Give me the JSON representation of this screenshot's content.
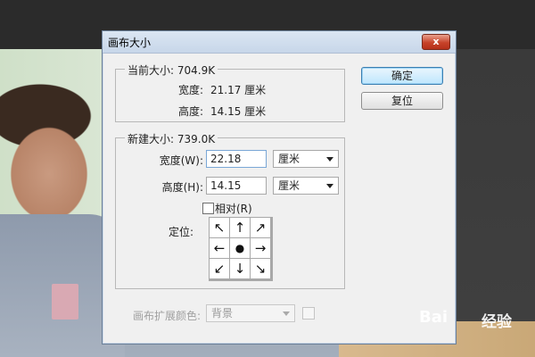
{
  "dialog": {
    "title": "画布大小",
    "close_label": "x"
  },
  "current_size": {
    "label": "当前大小: 704.9K",
    "width_label": "宽度:",
    "width_value": "21.17 厘米",
    "height_label": "高度:",
    "height_value": "14.15 厘米"
  },
  "new_size": {
    "label": "新建大小: 739.0K",
    "width_label": "宽度(W):",
    "width_value": "22.18",
    "width_unit": "厘米",
    "height_label": "高度(H):",
    "height_value": "14.15",
    "height_unit": "厘米",
    "relative_label": "相对(R)",
    "anchor_label": "定位:",
    "anchor_cells": [
      "↖",
      "↑",
      "↗",
      "←",
      "●",
      "→",
      "↙",
      "↓",
      "↘"
    ]
  },
  "extension": {
    "label": "画布扩展颜色:",
    "value": "背景"
  },
  "buttons": {
    "ok": "确定",
    "reset": "复位"
  },
  "watermark": {
    "brand": "Bai",
    "brand2": "经验"
  },
  "colors": {
    "titlebar": "#c7d6e9",
    "close": "#c7432a",
    "dialog_bg": "#f0f0f0"
  }
}
